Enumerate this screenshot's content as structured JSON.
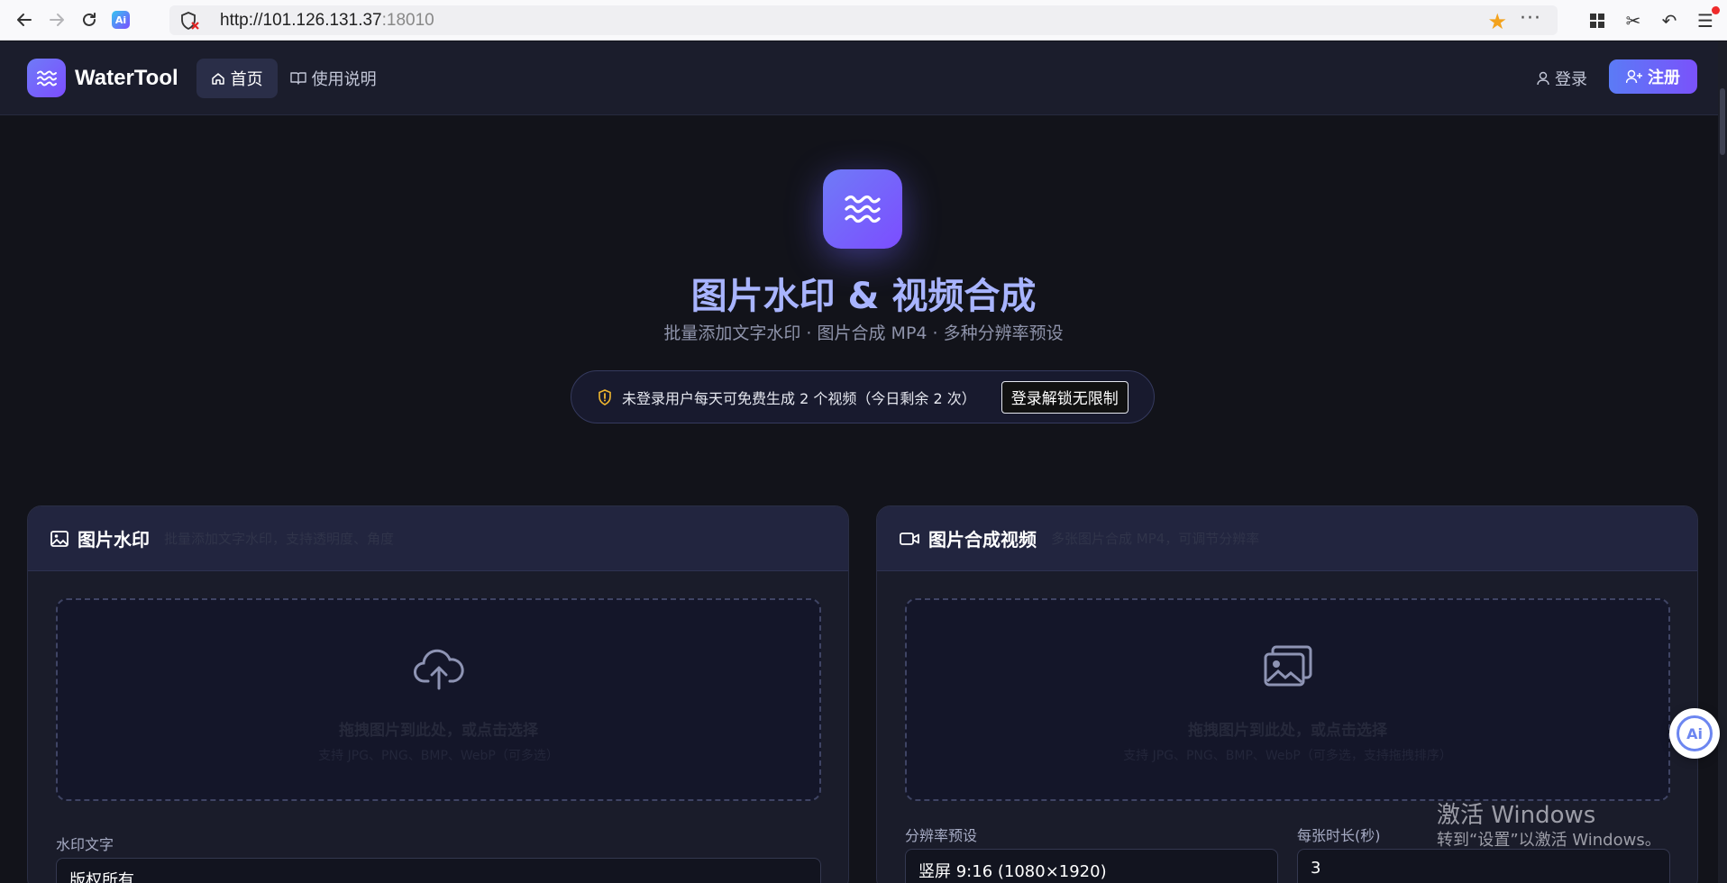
{
  "browser": {
    "url_host": "http://101.126.131.37",
    "url_port": ":18010",
    "extension_label": "Ai"
  },
  "header": {
    "brand": "WaterTool",
    "nav_home": "首页",
    "nav_guide": "使用说明",
    "login": "登录",
    "register": "注册"
  },
  "hero": {
    "title": "图片水印 & 视频合成",
    "subtitle": "批量添加文字水印 · 图片合成 MP4 · 多种分辨率预设",
    "notice": "未登录用户每天可免费生成 2 个视频（今日剩余 2 次）",
    "notice_button": "登录解锁无限制"
  },
  "watermark_card": {
    "title": "图片水印",
    "hint": "批量添加文字水印，支持透明度、角度",
    "dropzone_main": "拖拽图片到此处，或点击选择",
    "dropzone_sub": "支持 JPG、PNG、BMP、WebP（可多选）",
    "text_label": "水印文字",
    "text_value": "版权所有"
  },
  "video_card": {
    "title": "图片合成视频",
    "hint": "多张图片合成 MP4，可调节分辨率",
    "dropzone_main": "拖拽图片到此处，或点击选择",
    "dropzone_sub": "支持 JPG、PNG、BMP、WebP（可多选，支持拖拽排序）",
    "resolution_label": "分辨率预设",
    "resolution_value": "竖屏 9:16 (1080×1920)",
    "duration_label": "每张时长(秒)",
    "duration_value": "3"
  },
  "ai_float": {
    "label": "Ai"
  },
  "windows_watermark": {
    "title": "激活 Windows",
    "subtitle": "转到“设置”以激活 Windows。"
  },
  "colors": {
    "accent": "#6f7bf7",
    "accent_purple": "#7c4dff",
    "page_bg": "#12131a",
    "header_bg": "#1b1d2c",
    "star": "#f3a21d"
  }
}
